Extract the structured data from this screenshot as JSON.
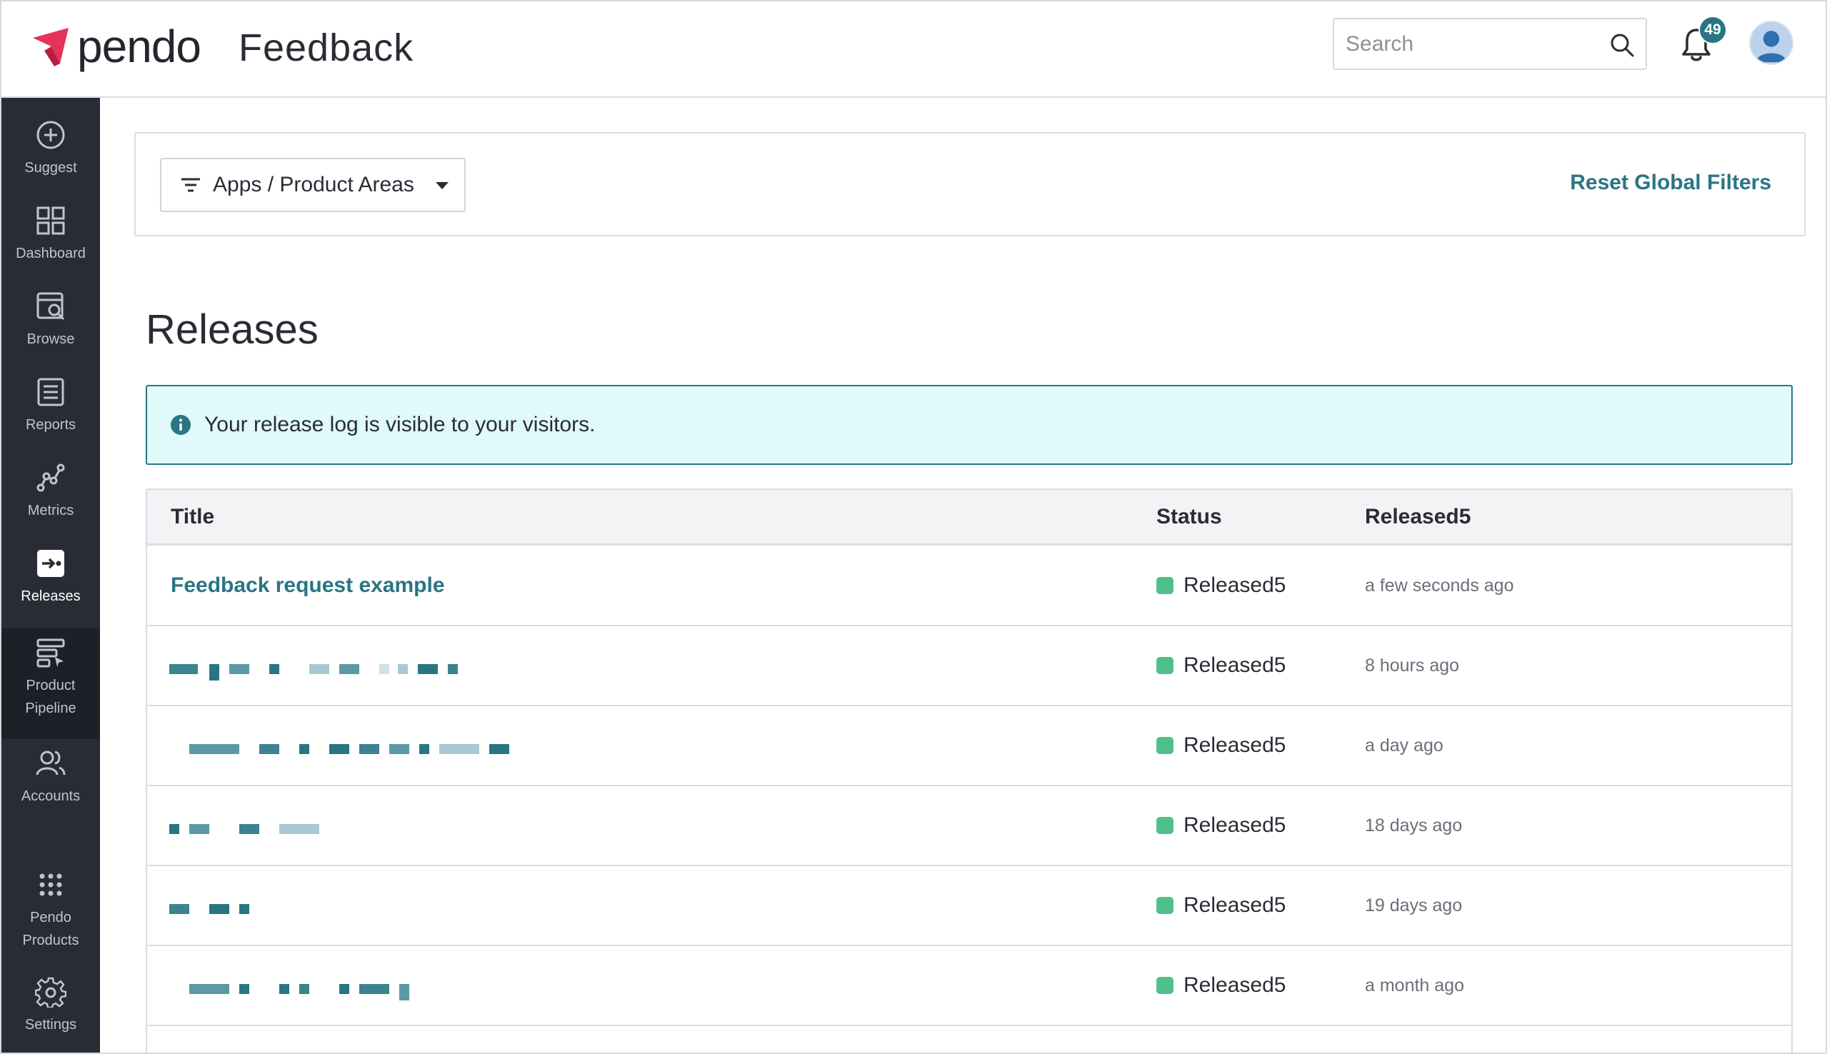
{
  "header": {
    "logo_text": "pendo",
    "app_title": "Feedback",
    "search_placeholder": "Search",
    "notification_count": "49"
  },
  "sidebar": {
    "items": [
      {
        "label": "Suggest",
        "icon": "plus-circle-icon"
      },
      {
        "label": "Dashboard",
        "icon": "grid-icon"
      },
      {
        "label": "Browse",
        "icon": "browse-icon"
      },
      {
        "label": "Reports",
        "icon": "list-icon"
      },
      {
        "label": "Metrics",
        "icon": "metrics-icon"
      },
      {
        "label": "Releases",
        "icon": "releases-icon",
        "active": true
      },
      {
        "label_line1": "Product",
        "label_line2": "Pipeline",
        "icon": "pipeline-icon"
      },
      {
        "label": "Accounts",
        "icon": "accounts-icon"
      },
      {
        "label_line1": "Pendo",
        "label_line2": "Products",
        "icon": "apps-grid-icon"
      },
      {
        "label": "Settings",
        "icon": "gear-icon"
      }
    ]
  },
  "filters": {
    "apps_label": "Apps / Product Areas",
    "reset_label": "Reset Global Filters"
  },
  "page": {
    "title": "Releases",
    "banner_text": "Your release log is visible to your visitors."
  },
  "table": {
    "columns": [
      "Title",
      "Status",
      "Released5"
    ],
    "rows": [
      {
        "title": "Feedback request example",
        "status": "Released5",
        "time": "a few seconds ago"
      },
      {
        "title": "",
        "status": "Released5",
        "time": "8 hours ago"
      },
      {
        "title": "",
        "status": "Released5",
        "time": "a day ago"
      },
      {
        "title": "",
        "status": "Released5",
        "time": "18 days ago"
      },
      {
        "title": "",
        "status": "Released5",
        "time": "19 days ago"
      },
      {
        "title": "",
        "status": "Released5",
        "time": "a month ago"
      }
    ]
  },
  "colors": {
    "accent": "#2a7584",
    "sidebar_bg": "#2a2c35",
    "status_released": "#4ec18a",
    "banner_bg": "#e0f9fb",
    "brand_red": "#e5335a"
  }
}
